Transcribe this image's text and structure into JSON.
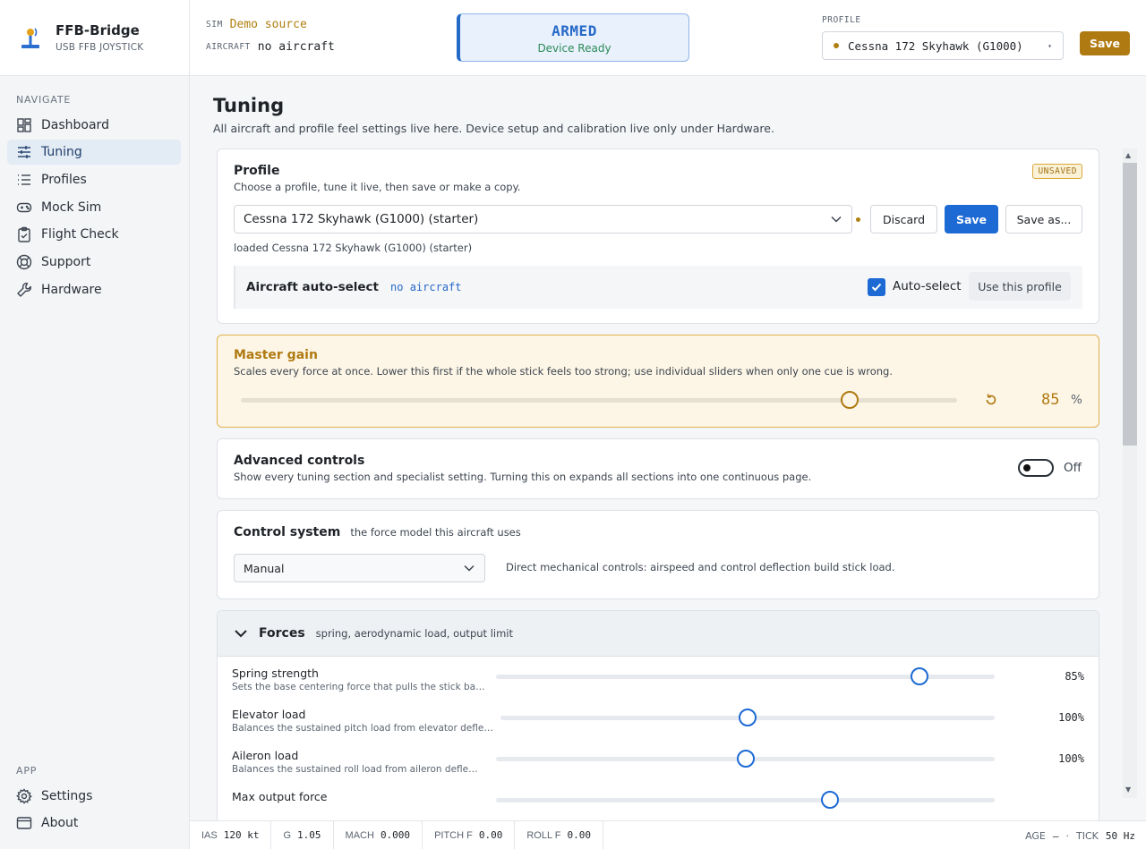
{
  "brand": {
    "title": "FFB-Bridge",
    "subtitle": "USB FFB JOYSTICK"
  },
  "sidebar": {
    "navigate_heading": "NAVIGATE",
    "items": [
      {
        "label": "Dashboard",
        "icon": "dashboard-icon",
        "active": false
      },
      {
        "label": "Tuning",
        "icon": "sliders-icon",
        "active": true
      },
      {
        "label": "Profiles",
        "icon": "list-icon",
        "active": false
      },
      {
        "label": "Mock Sim",
        "icon": "gamepad-icon",
        "active": false
      },
      {
        "label": "Flight Check",
        "icon": "clipboard-check-icon",
        "active": false
      },
      {
        "label": "Support",
        "icon": "lifebuoy-icon",
        "active": false
      },
      {
        "label": "Hardware",
        "icon": "wrench-icon",
        "active": false
      }
    ],
    "app_heading": "APP",
    "app_items": [
      {
        "label": "Settings",
        "icon": "gear-icon"
      },
      {
        "label": "About",
        "icon": "window-icon"
      }
    ]
  },
  "header": {
    "sim_label": "SIM",
    "sim_value": "Demo source",
    "aircraft_label": "AIRCRAFT",
    "aircraft_value": "no aircraft",
    "status_title": "ARMED",
    "status_sub": "Device Ready",
    "profile_label": "PROFILE",
    "profile_value": "Cessna 172 Skyhawk (G1000)",
    "save_label": "Save"
  },
  "page": {
    "title": "Tuning",
    "subtitle": "All aircraft and profile feel settings live here. Device setup and calibration live only under Hardware."
  },
  "profile_card": {
    "title": "Profile",
    "subtitle": "Choose a profile, tune it live, then save or make a copy.",
    "badge": "UNSAVED",
    "selected": "Cessna 172 Skyhawk (G1000) (starter)",
    "discard_label": "Discard",
    "save_label": "Save",
    "save_as_label": "Save as...",
    "loaded_text": "loaded Cessna 172 Skyhawk (G1000) (starter)",
    "autoselect_label": "Aircraft auto-select",
    "autoselect_value": "no aircraft",
    "autoselect_checkbox_label": "Auto-select",
    "autoselect_checked": true,
    "use_profile_label": "Use this profile"
  },
  "master_gain": {
    "title": "Master gain",
    "subtitle": "Scales every force at once. Lower this first if the whole stick feels too strong; use individual sliders when only one cue is wrong.",
    "value": "85",
    "unit": "%",
    "fraction": 0.85
  },
  "advanced": {
    "title": "Advanced controls",
    "subtitle": "Show every tuning section and specialist setting. Turning this on expands all sections into one continuous page.",
    "state_label": "Off",
    "enabled": false
  },
  "control_system": {
    "title": "Control system",
    "hint": "the force model this aircraft uses",
    "selected": "Manual",
    "description": "Direct mechanical controls: airspeed and control deflection build stick load."
  },
  "forces": {
    "title": "Forces",
    "hint": "spring, aerodynamic load, output limit",
    "rows": [
      {
        "label": "Spring strength",
        "desc": "Sets the base centering force that pulls the stick back toward center.",
        "value": "85%",
        "fraction": 0.85
      },
      {
        "label": "Elevator load",
        "desc": "Balances the sustained pitch load from elevator deflection and airspeed.",
        "value": "100%",
        "fraction": 0.5
      },
      {
        "label": "Aileron load",
        "desc": "Balances the sustained roll load from aileron deflection and airspeed.",
        "value": "100%",
        "fraction": 0.5
      },
      {
        "label": "Max output force",
        "desc": "",
        "value": "",
        "fraction": 0.67
      }
    ]
  },
  "footer": {
    "cells": [
      {
        "k": "IAS",
        "v": "120 kt"
      },
      {
        "k": "G",
        "v": "1.05"
      },
      {
        "k": "MACH",
        "v": "0.000"
      },
      {
        "k": "PITCH F",
        "v": "0.00"
      },
      {
        "k": "ROLL F",
        "v": "0.00"
      }
    ],
    "age_label": "AGE",
    "age_value": "—",
    "sep": "·",
    "tick_label": "TICK",
    "tick_value": "50 Hz"
  },
  "colors": {
    "accent": "#1d6ad4",
    "warn": "#b07a12",
    "ok": "#2a8a56"
  }
}
